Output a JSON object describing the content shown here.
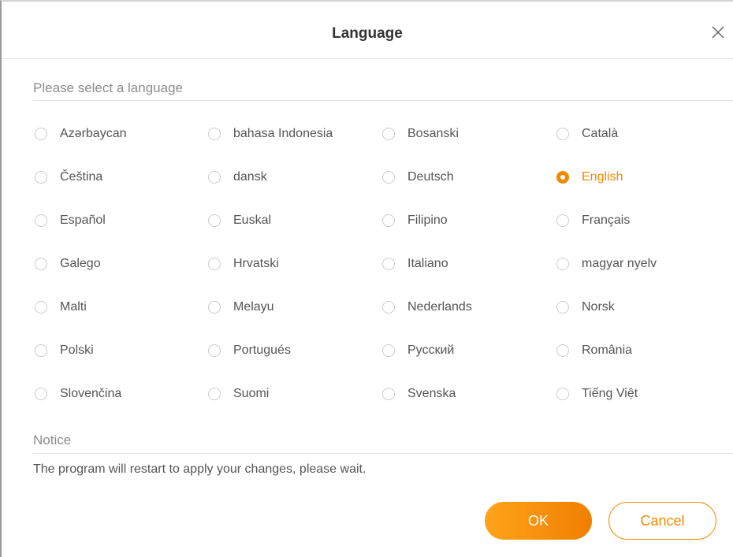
{
  "dialog": {
    "title": "Language",
    "select_label": "Please select a language",
    "notice_label": "Notice",
    "notice_text": "The program will restart to apply your changes, please wait.",
    "ok_label": "OK",
    "cancel_label": "Cancel",
    "accent_color": "#f08a00",
    "close_icon": "close-icon"
  },
  "languages": [
    {
      "label": "Azərbaycan",
      "selected": false
    },
    {
      "label": "bahasa Indonesia",
      "selected": false
    },
    {
      "label": "Bosanski",
      "selected": false
    },
    {
      "label": "Català",
      "selected": false
    },
    {
      "label": "Čeština",
      "selected": false
    },
    {
      "label": "dansk",
      "selected": false
    },
    {
      "label": "Deutsch",
      "selected": false
    },
    {
      "label": "English",
      "selected": true
    },
    {
      "label": "Español",
      "selected": false
    },
    {
      "label": "Euskal",
      "selected": false
    },
    {
      "label": "Filipino",
      "selected": false
    },
    {
      "label": "Français",
      "selected": false
    },
    {
      "label": "Galego",
      "selected": false
    },
    {
      "label": "Hrvatski",
      "selected": false
    },
    {
      "label": "Italiano",
      "selected": false
    },
    {
      "label": "magyar nyelv",
      "selected": false
    },
    {
      "label": "Malti",
      "selected": false
    },
    {
      "label": "Melayu",
      "selected": false
    },
    {
      "label": "Nederlands",
      "selected": false
    },
    {
      "label": "Norsk",
      "selected": false
    },
    {
      "label": "Polski",
      "selected": false
    },
    {
      "label": "Portugués",
      "selected": false
    },
    {
      "label": "Русский",
      "selected": false
    },
    {
      "label": "România",
      "selected": false
    },
    {
      "label": "Slovenčina",
      "selected": false
    },
    {
      "label": "Suomi",
      "selected": false
    },
    {
      "label": "Svenska",
      "selected": false
    },
    {
      "label": "Tiếng Việt",
      "selected": false
    }
  ]
}
